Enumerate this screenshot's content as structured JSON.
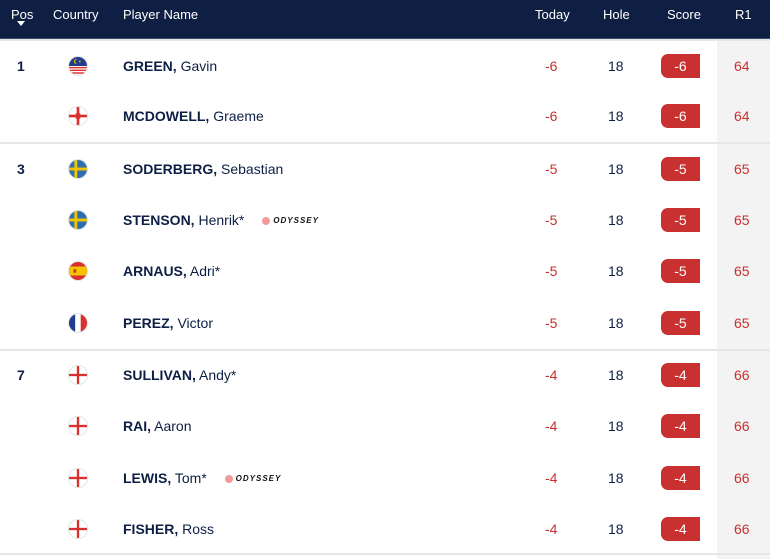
{
  "header": {
    "pos": "Pos",
    "sort_icon": "caret-down",
    "country": "Country",
    "player": "Player Name",
    "today": "Today",
    "hole": "Hole",
    "score": "Score",
    "r1": "R1"
  },
  "colors": {
    "header_bg": "#0e1f43",
    "under_par": "#c8312f",
    "text": "#0d1f44",
    "r1_bg": "#f3f3f3"
  },
  "rows": [
    {
      "pos": "1",
      "country": "Malaysia",
      "last": "GREEN,",
      "first": " Gavin",
      "sponsor": "",
      "today": "-6",
      "hole": "18",
      "score": "-6",
      "r1": "64",
      "group_start": true
    },
    {
      "pos": "",
      "country": "Northern Ireland",
      "last": "MCDOWELL,",
      "first": " Graeme",
      "sponsor": "",
      "today": "-6",
      "hole": "18",
      "score": "-6",
      "r1": "64",
      "group_start": false
    },
    {
      "pos": "3",
      "country": "Sweden",
      "last": "SODERBERG,",
      "first": " Sebastian",
      "sponsor": "",
      "today": "-5",
      "hole": "18",
      "score": "-5",
      "r1": "65",
      "group_start": true
    },
    {
      "pos": "",
      "country": "Sweden",
      "last": "STENSON,",
      "first": " Henrik*",
      "sponsor": "ODYSSEY",
      "today": "-5",
      "hole": "18",
      "score": "-5",
      "r1": "65",
      "group_start": false
    },
    {
      "pos": "",
      "country": "Spain",
      "last": "ARNAUS,",
      "first": " Adri*",
      "sponsor": "",
      "today": "-5",
      "hole": "18",
      "score": "-5",
      "r1": "65",
      "group_start": false
    },
    {
      "pos": "",
      "country": "France",
      "last": "PEREZ,",
      "first": " Victor",
      "sponsor": "",
      "today": "-5",
      "hole": "18",
      "score": "-5",
      "r1": "65",
      "group_start": false
    },
    {
      "pos": "7",
      "country": "England",
      "last": "SULLIVAN,",
      "first": " Andy*",
      "sponsor": "",
      "today": "-4",
      "hole": "18",
      "score": "-4",
      "r1": "66",
      "group_start": true
    },
    {
      "pos": "",
      "country": "England",
      "last": "RAI,",
      "first": " Aaron",
      "sponsor": "",
      "today": "-4",
      "hole": "18",
      "score": "-4",
      "r1": "66",
      "group_start": false
    },
    {
      "pos": "",
      "country": "England",
      "last": "LEWIS,",
      "first": " Tom*",
      "sponsor": "ODYSSEY",
      "today": "-4",
      "hole": "18",
      "score": "-4",
      "r1": "66",
      "group_start": false
    },
    {
      "pos": "",
      "country": "England",
      "last": "FISHER,",
      "first": " Ross",
      "sponsor": "",
      "today": "-4",
      "hole": "18",
      "score": "-4",
      "r1": "66",
      "group_start": false
    }
  ]
}
